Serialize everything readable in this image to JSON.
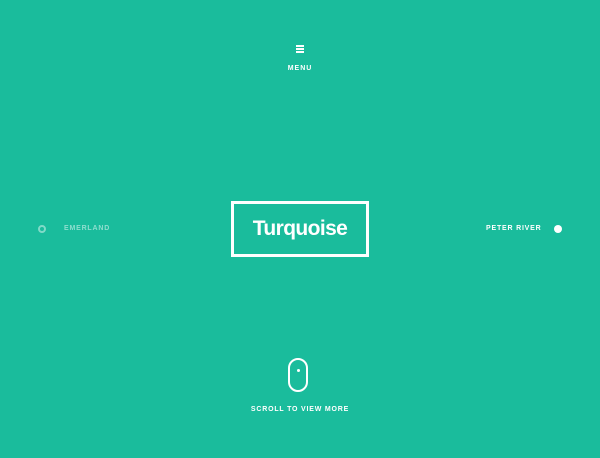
{
  "theme": {
    "background_color": "#1abc9c",
    "text_color": "#ffffff"
  },
  "menu": {
    "icon": "hamburger-icon",
    "label": "MENU"
  },
  "nav": {
    "previous": {
      "label": "EMERLAND",
      "icon": "ring-icon"
    },
    "next": {
      "label": "PETER RIVER",
      "icon": "dot-icon"
    }
  },
  "hero": {
    "title": "Turquoise"
  },
  "scroll_hint": {
    "icon": "mouse-icon",
    "label": "SCROLL TO VIEW MORE"
  }
}
